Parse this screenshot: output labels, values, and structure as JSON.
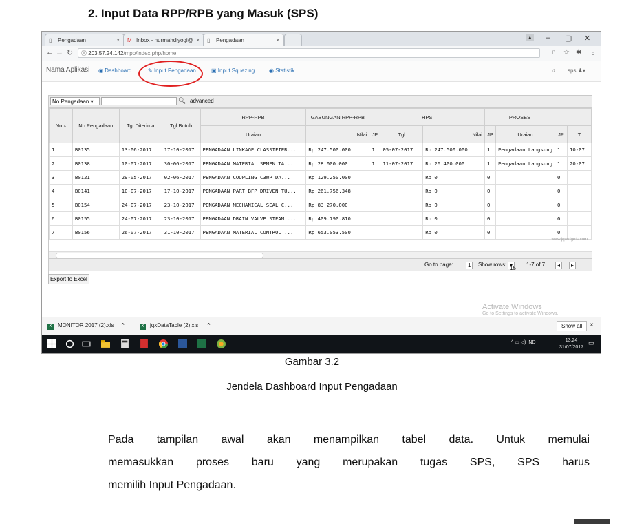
{
  "heading": "2.  Input Data RPP/RPB yang Masuk (SPS)",
  "browser": {
    "tabs": [
      {
        "label": "Pengadaan",
        "icon": "page-icon"
      },
      {
        "label": "Inbox - nurmahdiyogi@",
        "icon": "gmail-icon"
      },
      {
        "label": "Pengadaan",
        "icon": "page-icon"
      }
    ],
    "tab_close": "×",
    "url_host": "203.57.24.142",
    "url_path": "/mpp/index.php/home",
    "window_min": "–",
    "window_max": "▢",
    "window_close": "✕"
  },
  "app": {
    "brand": "Nama Aplikasi",
    "nav": [
      {
        "label": "Dashboard",
        "icon": "dashboard-icon"
      },
      {
        "label": "Input Pengadaan",
        "icon": "pencil-icon"
      },
      {
        "label": "Input Squezing",
        "icon": "edit-icon"
      },
      {
        "label": "Statistik",
        "icon": "statistics-icon"
      }
    ],
    "user": "sps"
  },
  "grid": {
    "filter_select": "No Pengadaan",
    "advanced_label": "advanced",
    "group_headers": [
      "RPP-RPB",
      "GABUNGAN RPP-RPB",
      "HPS",
      "PROSES"
    ],
    "headers": [
      "No",
      "No Pengadaan",
      "Tgl Diterima",
      "Tgl Butuh",
      "Uraian",
      "Nilai",
      "JP",
      "Tgl",
      "Nilai",
      "JP",
      "Uraian",
      "JP",
      "T"
    ],
    "rows": [
      [
        "1",
        "B0135",
        "13-06-2017",
        "17-10-2017",
        "PENGADAAN LINKAGE CLASSIFIER...",
        "Rp 247.500.000",
        "1",
        "05-07-2017",
        "Rp 247.500.000",
        "1",
        "Pengadaan Langsung",
        "1",
        "10-07"
      ],
      [
        "2",
        "B0138",
        "10-07-2017",
        "30-06-2017",
        "PENGADAAN MATERIAL SEMEN TA...",
        "Rp 28.000.000",
        "1",
        "11-07-2017",
        "Rp 26.400.000",
        "1",
        "Pengadaan Langsung",
        "1",
        "20-07"
      ],
      [
        "3",
        "B0121",
        "29-05-2017",
        "02-06-2017",
        "PENGADAAN COUPLING C3WP DA...",
        "Rp 129.250.000",
        "",
        "",
        "Rp 0",
        "0",
        "",
        "0",
        ""
      ],
      [
        "4",
        "B0141",
        "10-07-2017",
        "17-10-2017",
        "PENGADAAN PART BFP DRIVEN TU...",
        "Rp 261.756.348",
        "",
        "",
        "Rp 0",
        "0",
        "",
        "0",
        ""
      ],
      [
        "5",
        "B0154",
        "24-07-2017",
        "23-10-2017",
        "PENGADAAN MECHANICAL SEAL C...",
        "Rp 83.270.000",
        "",
        "",
        "Rp 0",
        "0",
        "",
        "0",
        ""
      ],
      [
        "6",
        "B0155",
        "24-07-2017",
        "23-10-2017",
        "PENGADAAN DRAIN VALVE STEAM ...",
        "Rp 409.790.810",
        "",
        "",
        "Rp 0",
        "0",
        "",
        "0",
        ""
      ],
      [
        "7",
        "B0156",
        "26-07-2017",
        "31-10-2017",
        "PENGADAAN MATERIAL CONTROL ...",
        "Rp 653.053.500",
        "",
        "",
        "Rp 0",
        "0",
        "",
        "0",
        ""
      ]
    ],
    "watermark": "www.jqwidgets.com",
    "goto_label": "Go to page:",
    "goto_value": "1",
    "show_rows_label": "Show rows:",
    "show_rows_value": "15",
    "range_label": "1-7 of 7"
  },
  "export_label": "Export to Excel",
  "activate": {
    "title": "Activate Windows",
    "subtitle": "Go to Settings to activate Windows."
  },
  "downloads": {
    "items": [
      "MONITOR 2017 (2).xls",
      "jqxDataTable (2).xls"
    ],
    "show_all": "Show all",
    "close": "×"
  },
  "taskbar": {
    "lang": "IND",
    "time": "13.24",
    "date": "31/07/2017"
  },
  "caption": {
    "figure": "Gambar 3.2",
    "title": "Jendela Dashboard Input Pengadaan"
  },
  "paragraph": {
    "line1": "Pada tampilan awal akan menampilkan tabel data. Untuk memulai",
    "line2": "memasukkan proses baru yang merupakan tugas SPS, SPS harus",
    "line3": "memilih Input Pengadaan."
  },
  "colors": {
    "link": "#2a6fb3",
    "highlight_circle": "#e02020",
    "taskbar": "#101418",
    "excel": "#1e7145"
  }
}
